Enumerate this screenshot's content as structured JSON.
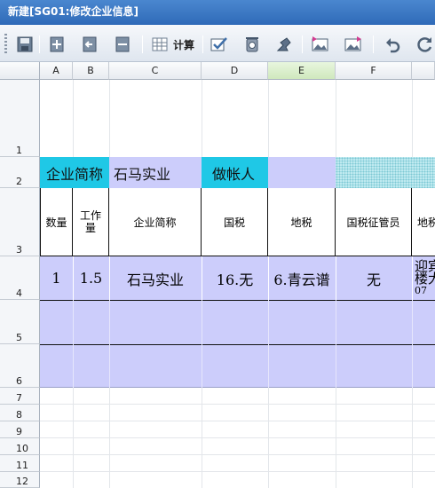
{
  "window": {
    "title": "新建[SG01:修改企业信息]"
  },
  "toolbar": {
    "calc_label": "计算",
    "icons": [
      "save-icon",
      "add-icon",
      "back-icon",
      "delete-icon",
      "grid-icon",
      "edit-check-icon",
      "trash-icon",
      "export-icon",
      "image-icon",
      "image-edit-icon",
      "undo-icon",
      "refresh-icon"
    ]
  },
  "sheet": {
    "columns": [
      "A",
      "B",
      "C",
      "D",
      "E",
      "F"
    ],
    "selected_column": "E",
    "rows": [
      "1",
      "2",
      "3",
      "4",
      "5",
      "6",
      "7",
      "8",
      "9",
      "10",
      "11",
      "12"
    ],
    "row2": {
      "label1": "企业简称",
      "value1": "石马实业",
      "label2": "做帐人",
      "value2": ""
    },
    "headers": [
      "数量",
      "工作量",
      "企业简称",
      "国税",
      "地税",
      "国税征管员",
      "地税"
    ],
    "record": {
      "qty": "1",
      "workload": "1.5",
      "name": "石马实业",
      "national_tax": "16.无",
      "local_tax": "6.青云谱",
      "national_officer": "无",
      "local_officer_line1": "迎宾",
      "local_officer_line2": "楼大",
      "local_officer_line3": "07"
    }
  },
  "colors": {
    "accent_cyan": "#1fc8e6",
    "lavender": "#cccdfb",
    "title_bar": "#2f6ab8"
  }
}
